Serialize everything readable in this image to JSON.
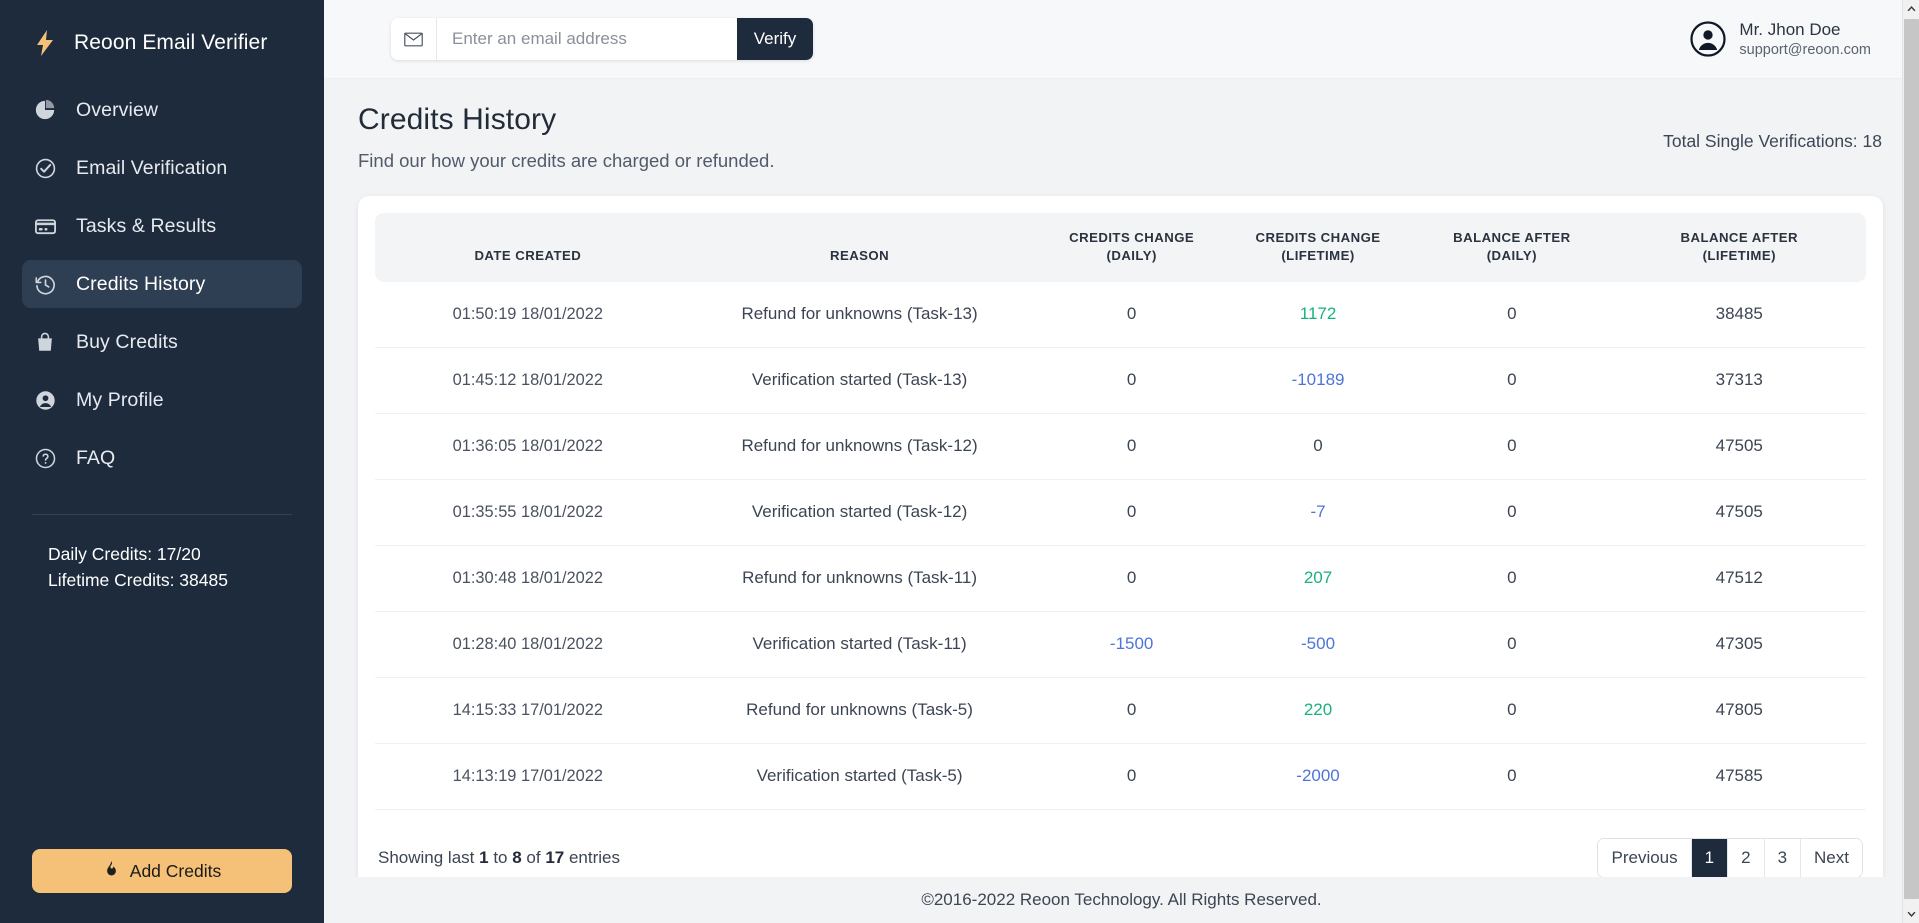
{
  "sidebar": {
    "brand": {
      "label": "Reoon Email Verifier",
      "icon": "bolt-icon"
    },
    "items": [
      {
        "label": "Overview",
        "icon": "pie-chart-icon",
        "active": false
      },
      {
        "label": "Email Verification",
        "icon": "check-circle-icon",
        "active": false
      },
      {
        "label": "Tasks & Results",
        "icon": "card-icon",
        "active": false
      },
      {
        "label": "Credits History",
        "icon": "history-clock-icon",
        "active": true
      },
      {
        "label": "Buy Credits",
        "icon": "shopping-bag-icon",
        "active": false
      },
      {
        "label": "My Profile",
        "icon": "user-circle-icon",
        "active": false
      },
      {
        "label": "FAQ",
        "icon": "question-circle-icon",
        "active": false
      }
    ],
    "daily_credits": "Daily Credits: 17/20",
    "lifetime_credits": "Lifetime Credits: 38485",
    "add_credits_label": "Add Credits",
    "add_credits_icon": "flame-icon",
    "bg_color": "#1e2b3c",
    "accent_color": "#f5c077"
  },
  "topbar": {
    "mail_icon": "envelope-icon",
    "email_placeholder": "Enter an email address",
    "email_value": "",
    "verify_label": "Verify",
    "user": {
      "avatar_icon": "user-avatar-icon",
      "name": "Mr. Jhon Doe",
      "email": "support@reoon.com"
    }
  },
  "page": {
    "title": "Credits History",
    "subtitle": "Find our how your credits are charged or refunded.",
    "total_verifications": "Total Single Verifications: 18"
  },
  "table": {
    "columns": [
      {
        "line1": "DATE CREATED",
        "line2": ""
      },
      {
        "line1": "REASON",
        "line2": ""
      },
      {
        "line1": "CREDITS CHANGE",
        "line2": "(DAILY)"
      },
      {
        "line1": "CREDITS CHANGE",
        "line2": "(LIFETIME)"
      },
      {
        "line1": "BALANCE AFTER",
        "line2": "(DAILY)"
      },
      {
        "line1": "BALANCE AFTER",
        "line2": "(LIFETIME)"
      }
    ],
    "rows": [
      {
        "date": "01:50:19 18/01/2022",
        "reason": "Refund for unknowns (Task-13)",
        "credits_daily": "0",
        "credits_daily_sign": "zero",
        "credits_lifetime": "1172",
        "credits_lifetime_sign": "pos",
        "balance_daily": "0",
        "balance_lifetime": "38485"
      },
      {
        "date": "01:45:12 18/01/2022",
        "reason": "Verification started (Task-13)",
        "credits_daily": "0",
        "credits_daily_sign": "zero",
        "credits_lifetime": "-10189",
        "credits_lifetime_sign": "neg",
        "balance_daily": "0",
        "balance_lifetime": "37313"
      },
      {
        "date": "01:36:05 18/01/2022",
        "reason": "Refund for unknowns (Task-12)",
        "credits_daily": "0",
        "credits_daily_sign": "zero",
        "credits_lifetime": "0",
        "credits_lifetime_sign": "zero",
        "balance_daily": "0",
        "balance_lifetime": "47505"
      },
      {
        "date": "01:35:55 18/01/2022",
        "reason": "Verification started (Task-12)",
        "credits_daily": "0",
        "credits_daily_sign": "zero",
        "credits_lifetime": "-7",
        "credits_lifetime_sign": "neg",
        "balance_daily": "0",
        "balance_lifetime": "47505"
      },
      {
        "date": "01:30:48 18/01/2022",
        "reason": "Refund for unknowns (Task-11)",
        "credits_daily": "0",
        "credits_daily_sign": "zero",
        "credits_lifetime": "207",
        "credits_lifetime_sign": "pos",
        "balance_daily": "0",
        "balance_lifetime": "47512"
      },
      {
        "date": "01:28:40 18/01/2022",
        "reason": "Verification started (Task-11)",
        "credits_daily": "-1500",
        "credits_daily_sign": "neg",
        "credits_lifetime": "-500",
        "credits_lifetime_sign": "neg",
        "balance_daily": "0",
        "balance_lifetime": "47305"
      },
      {
        "date": "14:15:33 17/01/2022",
        "reason": "Refund for unknowns (Task-5)",
        "credits_daily": "0",
        "credits_daily_sign": "zero",
        "credits_lifetime": "220",
        "credits_lifetime_sign": "pos",
        "balance_daily": "0",
        "balance_lifetime": "47805"
      },
      {
        "date": "14:13:19 17/01/2022",
        "reason": "Verification started (Task-5)",
        "credits_daily": "0",
        "credits_daily_sign": "zero",
        "credits_lifetime": "-2000",
        "credits_lifetime_sign": "neg",
        "balance_daily": "0",
        "balance_lifetime": "47585"
      }
    ],
    "showing": {
      "prefix": "Showing last ",
      "from": "1",
      "mid": " to ",
      "to": "8",
      "mid2": " of ",
      "total": "17",
      "suffix": " entries"
    },
    "pagination": [
      {
        "label": "Previous",
        "active": false
      },
      {
        "label": "1",
        "active": true
      },
      {
        "label": "2",
        "active": false
      },
      {
        "label": "3",
        "active": false
      },
      {
        "label": "Next",
        "active": false
      }
    ],
    "positive_color": "#19b27e",
    "negative_color": "#4d74d8"
  },
  "footer": {
    "copyright": "©2016-2022 Reoon Technology. All Rights Reserved."
  }
}
